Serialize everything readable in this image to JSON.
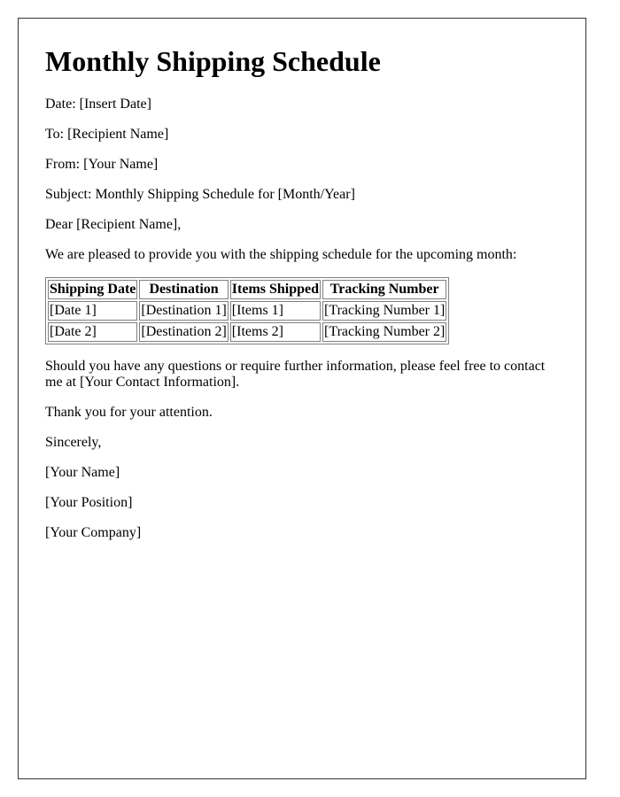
{
  "document": {
    "title": "Monthly Shipping Schedule",
    "date_line": "Date: [Insert Date]",
    "to_line": "To: [Recipient Name]",
    "from_line": "From: [Your Name]",
    "subject_line": "Subject: Monthly Shipping Schedule for [Month/Year]",
    "salutation": "Dear [Recipient Name],",
    "intro": "We are pleased to provide you with the shipping schedule for the upcoming month:",
    "table": {
      "headers": [
        "Shipping Date",
        "Destination",
        "Items Shipped",
        "Tracking Number"
      ],
      "rows": [
        [
          "[Date 1]",
          "[Destination 1]",
          "[Items 1]",
          "[Tracking Number 1]"
        ],
        [
          "[Date 2]",
          "[Destination 2]",
          "[Items 2]",
          "[Tracking Number 2]"
        ]
      ]
    },
    "contact_paragraph": "Should you have any questions or require further information, please feel free to contact me at [Your Contact Information].",
    "thanks": "Thank you for your attention.",
    "closing": "Sincerely,",
    "signature_name": "[Your Name]",
    "signature_position": "[Your Position]",
    "signature_company": "[Your Company]"
  }
}
